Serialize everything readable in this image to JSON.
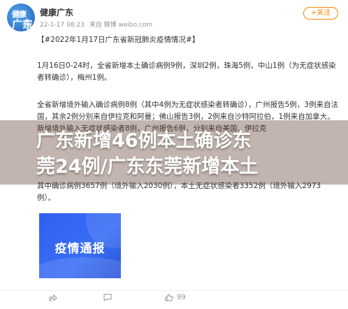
{
  "user": {
    "avatar_line1": "健康",
    "avatar_line2": "广东",
    "name": "健康广东",
    "time": "22-1-17 08:23",
    "source": "来自 微博 weibo.com"
  },
  "follow_label": "+关注",
  "post": {
    "topic": "【#2022年1月17日广东省新冠肺炎疫情情况#】",
    "para1": "1月16日0-24时，全省新增本土确诊病例9例，深圳2例，珠海5例，中山1例（为无症状感染者转确诊），梅州1例。",
    "para2": "全省新增境外输入确诊病例8例（其中4例为无症状感染者转确诊），广州报告5例，3例来自法国，其余2例分别来自伊拉克和阿曼；佛山报告3例，2例来自沙特阿拉伯，1例来自加拿大。新增境外输入无症状感染者8例，广州报告6例，分别来自美国、伊拉克",
    "para3": "其中确诊病例3657例（境外输入2030例），本土无症状感染者3352例（境外输入2973例）。",
    "cover_title": "疫情通报"
  },
  "headline": {
    "line1": "广东新增46例本土确诊东",
    "line2": "莞24例/广东东莞新增本土"
  },
  "actions": {
    "share_count": "",
    "comment_count": "",
    "like_count": "99"
  },
  "colors": {
    "accent": "#ff8200",
    "link": "#eb7350",
    "cover_blue": "#2f5ff0"
  }
}
